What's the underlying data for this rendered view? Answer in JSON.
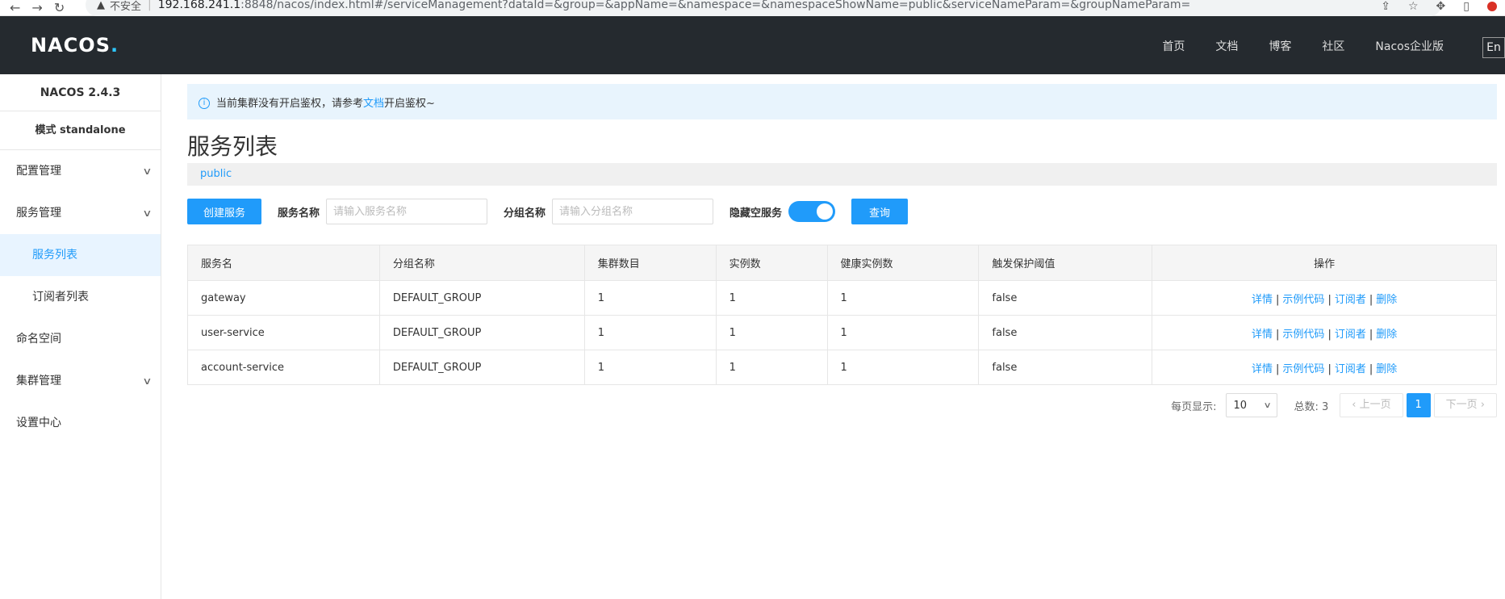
{
  "browser": {
    "security_label": "不安全",
    "host": "192.168.241.1",
    "path": ":8848/nacos/index.html#/serviceManagement?dataId=&group=&appName=&namespace=&namespaceShowName=public&serviceNameParam=&groupNameParam="
  },
  "header": {
    "logo_text_1": "NA",
    "logo_text_2": "C",
    "logo_text_3": "OS",
    "logo_dot": ".",
    "nav": [
      "首页",
      "文档",
      "博客",
      "社区",
      "Nacos企业版"
    ],
    "lang_button": "En"
  },
  "sidebar": {
    "version": "NACOS 2.4.3",
    "mode": "模式 standalone",
    "items": [
      {
        "label": "配置管理",
        "expandable": true
      },
      {
        "label": "服务管理",
        "expandable": true
      },
      {
        "label": "服务列表",
        "sub": true,
        "active": true
      },
      {
        "label": "订阅者列表",
        "sub": true
      },
      {
        "label": "命名空间"
      },
      {
        "label": "集群管理",
        "expandable": true
      },
      {
        "label": "设置中心"
      }
    ]
  },
  "notice": {
    "prefix": "当前集群没有开启鉴权，请参考",
    "link": "文档",
    "suffix": "开启鉴权~"
  },
  "page_title": "服务列表",
  "namespace": "public",
  "toolbar": {
    "create_label": "创建服务",
    "service_name_label": "服务名称",
    "service_name_placeholder": "请输入服务名称",
    "group_name_label": "分组名称",
    "group_name_placeholder": "请输入分组名称",
    "hide_empty_label": "隐藏空服务",
    "hide_empty_on": true,
    "query_label": "查询"
  },
  "table": {
    "headers": [
      "服务名",
      "分组名称",
      "集群数目",
      "实例数",
      "健康实例数",
      "触发保护阈值",
      "操作"
    ],
    "rows": [
      [
        "gateway",
        "DEFAULT_GROUP",
        "1",
        "1",
        "1",
        "false"
      ],
      [
        "user-service",
        "DEFAULT_GROUP",
        "1",
        "1",
        "1",
        "false"
      ],
      [
        "account-service",
        "DEFAULT_GROUP",
        "1",
        "1",
        "1",
        "false"
      ]
    ],
    "actions": [
      "详情",
      "示例代码",
      "订阅者",
      "删除"
    ],
    "action_separator": "|"
  },
  "pagination": {
    "page_size_label": "每页显示:",
    "page_size": "10",
    "total_label": "总数: 3",
    "prev_label": "上一页",
    "current_page": "1",
    "next_label": "下一页"
  },
  "colors": {
    "primary": "#209bfa",
    "header_bg": "#252a2f",
    "active_bg": "#e8f4ff"
  }
}
